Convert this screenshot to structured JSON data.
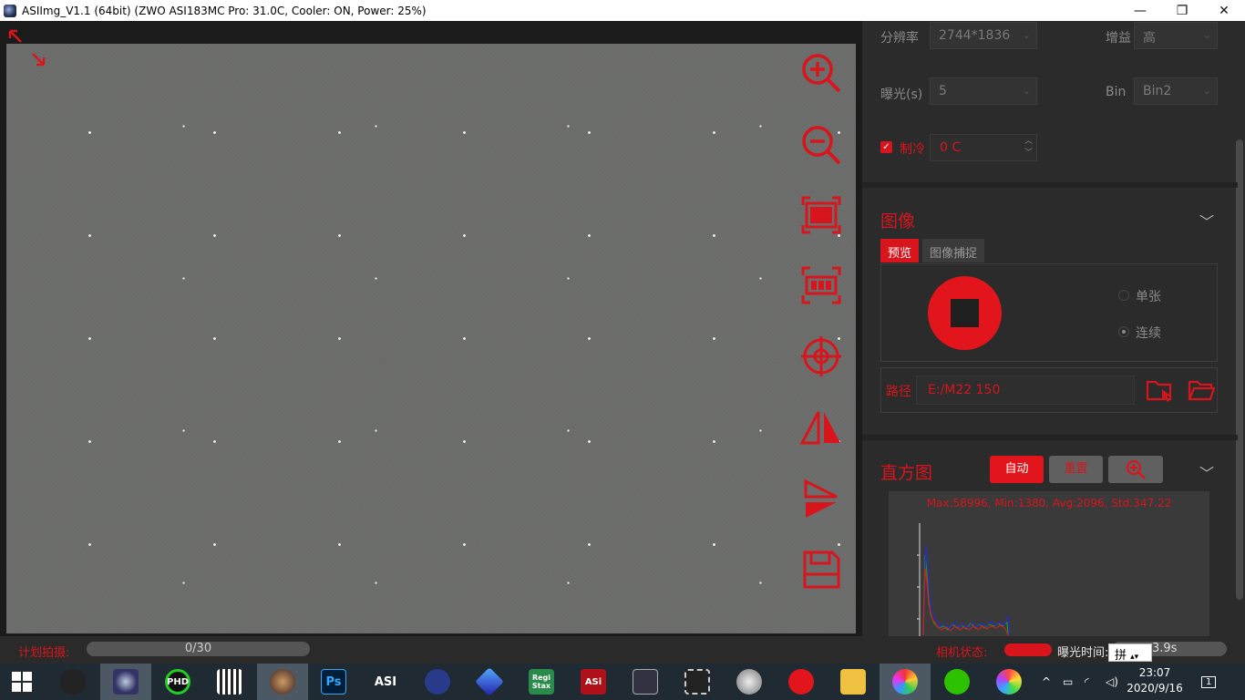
{
  "window": {
    "title": "ASIImg_V1.1 (64bit)  (ZWO ASI183MC Pro: 31.0C, Cooler: ON, Power: 25%)",
    "minimize": "—",
    "maximize": "❐",
    "close": "✕"
  },
  "camera_settings": {
    "resolution_label": "分辨率",
    "resolution_value": "2744*1836",
    "gain_label": "增益",
    "gain_value": "高",
    "exposure_label": "曝光(s)",
    "exposure_value": "5",
    "bin_label": "Bin",
    "bin_value": "Bin2",
    "cooling_label": "制冷",
    "cooling_checked": true,
    "cooling_value": "0 C"
  },
  "image_section": {
    "title": "图像",
    "tabs": [
      "预览",
      "图像捕捉"
    ],
    "active_tab": 0,
    "mode_options": [
      "单张",
      "连续"
    ],
    "selected_mode": "连续",
    "path_label": "路径",
    "path_value": "E:/M22 150"
  },
  "histogram": {
    "title": "直方图",
    "auto_button": "自动",
    "reset_button": "重置",
    "stats": "Max:58996, Min:1380, Avg:2096, Std:347.22"
  },
  "statusbar": {
    "plan_label": "计划拍摄:",
    "plan_progress": "0/30",
    "camera_status_label": "相机状态:",
    "exposure_time_label": "曝光时间:",
    "exposure_time_value": "3.9s",
    "ime_indicator": "拼"
  },
  "taskbar": {
    "apps": [
      {
        "name": "windows-start",
        "label": ""
      },
      {
        "name": "sharpcap",
        "label": ""
      },
      {
        "name": "asiimg",
        "label": ""
      },
      {
        "name": "phd2",
        "label": "PHD"
      },
      {
        "name": "deepskystacker",
        "label": ""
      },
      {
        "name": "autostakkert",
        "label": ""
      },
      {
        "name": "photoshop",
        "label": "Ps"
      },
      {
        "name": "asistudio",
        "label": "ASI"
      },
      {
        "name": "astroart",
        "label": ""
      },
      {
        "name": "gem",
        "label": ""
      },
      {
        "name": "registax",
        "label": "Regi Stax"
      },
      {
        "name": "asi-app",
        "label": "ASi"
      },
      {
        "name": "stacker",
        "label": ""
      },
      {
        "name": "film-app",
        "label": ""
      },
      {
        "name": "sky-app",
        "label": ""
      },
      {
        "name": "netease-music",
        "label": ""
      },
      {
        "name": "file-explorer",
        "label": ""
      },
      {
        "name": "chrome-like",
        "label": ""
      },
      {
        "name": "wechat",
        "label": ""
      },
      {
        "name": "color-app",
        "label": ""
      }
    ],
    "time": "23:07",
    "date": "2020/9/16",
    "notification_count": "1"
  },
  "colors": {
    "accent": "#d8151c",
    "panel_bg": "#2b2b2b"
  }
}
